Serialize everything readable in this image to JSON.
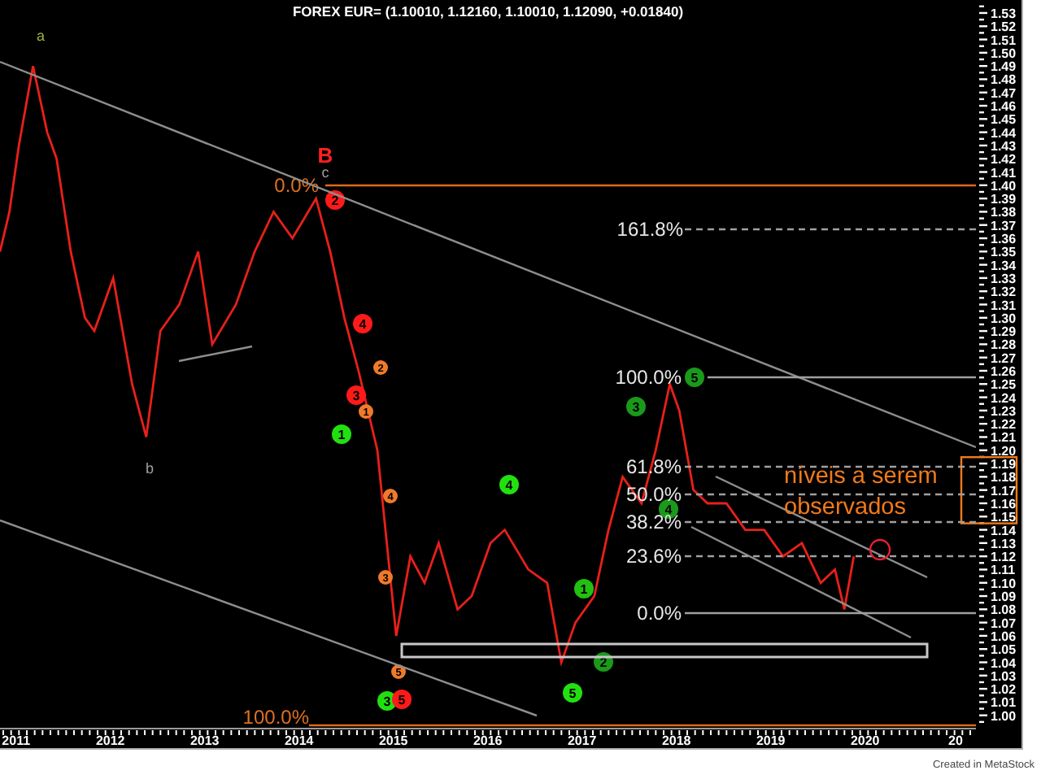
{
  "chart": {
    "chart_data": {
      "type": "line",
      "title": "FOREX EUR= (1.10010, 1.12160, 1.10010, 1.12090, +0.01840)",
      "x": [
        2010.83,
        2010.93,
        2011.03,
        2011.18,
        2011.33,
        2011.43,
        2011.58,
        2011.73,
        2011.83,
        2012.03,
        2012.23,
        2012.38,
        2012.53,
        2012.73,
        2012.93,
        2013.08,
        2013.33,
        2013.53,
        2013.73,
        2013.93,
        2014.18,
        2014.33,
        2014.48,
        2014.63,
        2014.83,
        2014.93,
        2015.03,
        2015.18,
        2015.33,
        2015.48,
        2015.68,
        2015.83,
        2016.03,
        2016.18,
        2016.43,
        2016.63,
        2016.78,
        2016.93,
        2017.13,
        2017.28,
        2017.43,
        2017.63,
        2017.78,
        2017.93,
        2018.03,
        2018.18,
        2018.33,
        2018.53,
        2018.73,
        2018.93,
        2019.13,
        2019.33,
        2019.53,
        2019.68,
        2019.78,
        2019.88
      ],
      "series": [
        {
          "color": "#e8201a",
          "values": [
            1.35,
            1.38,
            1.43,
            1.49,
            1.44,
            1.42,
            1.35,
            1.3,
            1.29,
            1.33,
            1.25,
            1.21,
            1.29,
            1.31,
            1.35,
            1.28,
            1.31,
            1.35,
            1.38,
            1.36,
            1.39,
            1.35,
            1.3,
            1.26,
            1.2,
            1.13,
            1.06,
            1.12,
            1.1,
            1.13,
            1.08,
            1.09,
            1.13,
            1.14,
            1.11,
            1.1,
            1.04,
            1.07,
            1.09,
            1.14,
            1.18,
            1.16,
            1.2,
            1.25,
            1.23,
            1.17,
            1.16,
            1.16,
            1.14,
            1.14,
            1.12,
            1.13,
            1.1,
            1.11,
            1.08,
            1.12
          ]
        }
      ],
      "xlim": [
        2010.83,
        2021.175
      ],
      "ylim": [
        0.99,
        1.5398
      ],
      "xticks": [
        2011,
        2012,
        2013,
        2014,
        2015,
        2016,
        2017,
        2018,
        2019,
        2020
      ],
      "yticks": [
        {
          "value": 1.53,
          "label": "1.53"
        },
        {
          "value": 1.52,
          "label": "1.52"
        },
        {
          "value": 1.51,
          "label": "1.51"
        },
        {
          "value": 1.5,
          "label": "1.50"
        },
        {
          "value": 1.49,
          "label": "1.49"
        },
        {
          "value": 1.48,
          "label": "1.48"
        },
        {
          "value": 1.47,
          "label": "1.47"
        },
        {
          "value": 1.46,
          "label": "1.46"
        },
        {
          "value": 1.45,
          "label": "1.45"
        },
        {
          "value": 1.44,
          "label": "1.44"
        },
        {
          "value": 1.43,
          "label": "1.43"
        },
        {
          "value": 1.42,
          "label": "1.42"
        },
        {
          "value": 1.41,
          "label": "1.41"
        },
        {
          "value": 1.4,
          "label": "1.40"
        },
        {
          "value": 1.39,
          "label": "1.39"
        },
        {
          "value": 1.38,
          "label": "1.38"
        },
        {
          "value": 1.37,
          "label": "1.37"
        },
        {
          "value": 1.36,
          "label": "1.36"
        },
        {
          "value": 1.35,
          "label": "1.35"
        },
        {
          "value": 1.34,
          "label": "1.34"
        },
        {
          "value": 1.33,
          "label": "1.33"
        },
        {
          "value": 1.32,
          "label": "1.32"
        },
        {
          "value": 1.31,
          "label": "1.31"
        },
        {
          "value": 1.3,
          "label": "1.30"
        },
        {
          "value": 1.29,
          "label": "1.29"
        },
        {
          "value": 1.28,
          "label": "1.28"
        },
        {
          "value": 1.27,
          "label": "1.27"
        },
        {
          "value": 1.26,
          "label": "1.26"
        },
        {
          "value": 1.25,
          "label": "1.25"
        },
        {
          "value": 1.24,
          "label": "1.24"
        },
        {
          "value": 1.23,
          "label": "1.23"
        },
        {
          "value": 1.22,
          "label": "1.22"
        },
        {
          "value": 1.21,
          "label": "1.21"
        },
        {
          "value": 1.2,
          "label": "1.20"
        },
        {
          "value": 1.19,
          "label": "1.19"
        },
        {
          "value": 1.18,
          "label": "1.18"
        },
        {
          "value": 1.17,
          "label": "1.17"
        },
        {
          "value": 1.16,
          "label": "1.16"
        },
        {
          "value": 1.15,
          "label": "1.15"
        },
        {
          "value": 1.14,
          "label": "1.14"
        },
        {
          "value": 1.13,
          "label": "1.13"
        },
        {
          "value": 1.12,
          "label": "1.12"
        },
        {
          "value": 1.11,
          "label": "1.11"
        },
        {
          "value": 1.1,
          "label": "1.10"
        },
        {
          "value": 1.09,
          "label": "1.09"
        },
        {
          "value": 1.08,
          "label": "1.08"
        },
        {
          "value": 1.07,
          "label": "1.07"
        },
        {
          "value": 1.06,
          "label": "1.06"
        },
        {
          "value": 1.05,
          "label": "1.05"
        },
        {
          "value": 1.04,
          "label": "1.04"
        },
        {
          "value": 1.03,
          "label": "1.03"
        },
        {
          "value": 1.02,
          "label": "1.02"
        },
        {
          "value": 1.01,
          "label": "1.01"
        },
        {
          "value": 1.0,
          "label": "1.00"
        }
      ]
    },
    "edge_label": "20",
    "wave_letters": [
      {
        "label": "a",
        "kind": "small",
        "color": "#9ab040"
      },
      {
        "label": "b",
        "kind": "small",
        "color": "#a0a0a0"
      },
      {
        "label": "B",
        "kind": "large",
        "color": "#ff2020"
      },
      {
        "label": "c",
        "kind": "small",
        "color": "#a0a0a0"
      }
    ],
    "wave_labels": [
      {
        "label": "2",
        "kind": "large",
        "color": "#ff1a1a"
      },
      {
        "label": "4",
        "kind": "large",
        "color": "#ff1a1a"
      },
      {
        "label": "2",
        "kind": "small",
        "color": "#f07a2a"
      },
      {
        "label": "3",
        "kind": "large",
        "color": "#ff1a1a"
      },
      {
        "label": "1",
        "kind": "small",
        "color": "#f07a2a"
      },
      {
        "label": "1",
        "kind": "large",
        "color": "#22e010"
      },
      {
        "label": "4",
        "kind": "small",
        "color": "#f07a2a"
      },
      {
        "label": "3",
        "kind": "small",
        "color": "#f07a2a"
      },
      {
        "label": "5",
        "kind": "small",
        "color": "#f07a2a"
      },
      {
        "label": "3",
        "kind": "large",
        "color": "#22e010"
      },
      {
        "label": "5",
        "kind": "large",
        "color": "#ff1a1a"
      },
      {
        "label": "4",
        "kind": "large",
        "color": "#22e010"
      },
      {
        "label": "1",
        "kind": "large",
        "color": "#22c010"
      },
      {
        "label": "2",
        "kind": "large",
        "color": "#1a9a1a"
      },
      {
        "label": "5",
        "kind": "large",
        "color": "#22e010"
      },
      {
        "label": "3",
        "kind": "large",
        "color": "#1a9a1a"
      },
      {
        "label": "5",
        "kind": "large",
        "color": "#1a9a1a"
      },
      {
        "label": "4",
        "kind": "large",
        "color": "#1a9a1a"
      }
    ],
    "fib_labels": [
      {
        "label": "0.0%",
        "color": "#e07020"
      },
      {
        "label": "100.0%",
        "color": "#e07020"
      },
      {
        "label": "161.8%",
        "color": "#e8e8e8"
      },
      {
        "label": "100.0%",
        "color": "#e8e8e8"
      },
      {
        "label": "61.8%",
        "color": "#e8e8e8"
      },
      {
        "label": "50.0%",
        "color": "#e8e8e8"
      },
      {
        "label": "38.2%",
        "color": "#e8e8e8"
      },
      {
        "label": "23.6%",
        "color": "#e8e8e8"
      },
      {
        "label": "0.0%",
        "color": "#e8e8e8"
      }
    ],
    "note": "níveis a serem observados"
  },
  "footer": "Created in MetaStock"
}
